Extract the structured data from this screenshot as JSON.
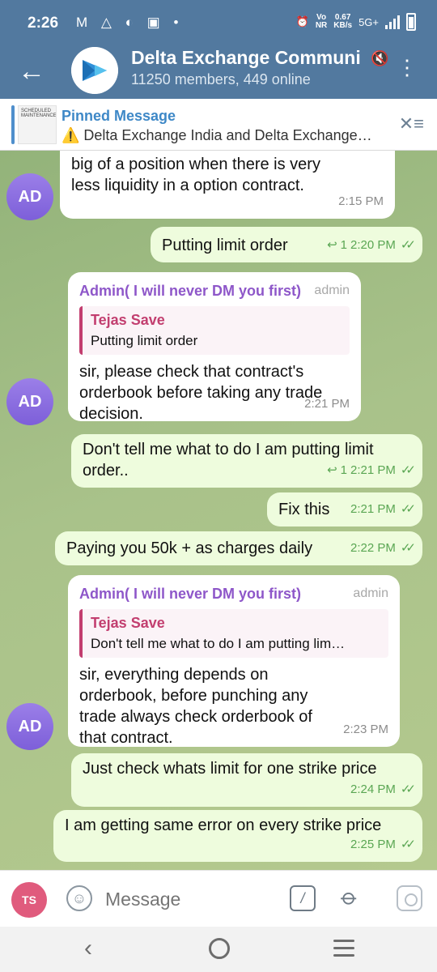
{
  "status_bar": {
    "time": "2:26",
    "net_speed": "0.67",
    "net_unit": "KB/s",
    "network": "5G+",
    "vo": "Vo",
    "nr": "NR"
  },
  "header": {
    "title": "Delta Exchange Communi",
    "subtitle": "11250 members, 449 online"
  },
  "pinned": {
    "title": "Pinned Message",
    "text": "⚠️ Delta Exchange India and Delta Exchange…",
    "thumb_text": "SCHEDULED MAINTENANCE"
  },
  "messages": [
    {
      "id": "m1",
      "direction": "in",
      "text_line1": "big of a position when there is very",
      "text_line2": "less liquidity in a option contract.",
      "time": "2:15 PM",
      "avatar": "AD"
    },
    {
      "id": "m2",
      "direction": "out",
      "text": "Putting limit order",
      "replies": "1",
      "time": "2:20 PM"
    },
    {
      "id": "m3",
      "direction": "in",
      "sender": "Admin( I will never DM you first)",
      "role": "admin",
      "quote_name": "Tejas Save",
      "quote_text": "Putting limit order",
      "text_line1": "sir, please check that contract's",
      "text_line2": "orderbook before taking any trade",
      "text_line3": "decision.",
      "time": "2:21 PM",
      "avatar": "AD"
    },
    {
      "id": "m4",
      "direction": "out",
      "text_line1": "Don't tell me what to do I am putting limit",
      "text_line2": "order..",
      "replies": "1",
      "time": "2:21 PM"
    },
    {
      "id": "m5",
      "direction": "out",
      "text": "Fix this",
      "time": "2:21 PM"
    },
    {
      "id": "m6",
      "direction": "out",
      "text": "Paying you 50k + as charges daily",
      "time": "2:22 PM"
    },
    {
      "id": "m7",
      "direction": "in",
      "sender": "Admin( I will never DM you first)",
      "role": "admin",
      "quote_name": "Tejas Save",
      "quote_text": "Don't tell me what to do I am putting lim…",
      "text_line1": "sir, everything depends on",
      "text_line2": "orderbook, before punching any",
      "text_line3": "trade always check orderbook of",
      "text_line4": "that contract.",
      "time": "2:23 PM",
      "avatar": "AD"
    },
    {
      "id": "m8",
      "direction": "out",
      "text": "Just check whats limit for one strike price",
      "time": "2:24 PM"
    },
    {
      "id": "m9",
      "direction": "out",
      "text": "I am getting same error on every strike price",
      "time": "2:25 PM"
    }
  ],
  "input": {
    "avatar": "TS",
    "placeholder": "Message"
  },
  "colors": {
    "header_bg": "#52799f",
    "outgoing_bubble": "#eefcdd",
    "incoming_bubble": "#ffffff",
    "sender_name": "#8e57c9",
    "quote_accent": "#c23e6f",
    "check_color": "#5aa653",
    "avatar_bg": "#8a6ee0"
  },
  "icons": [
    "back-arrow-icon",
    "mute-icon",
    "more-vertical-icon",
    "unpin-icon",
    "reply-count-icon",
    "double-check-icon",
    "emoji-icon",
    "bot-command-icon",
    "attach-icon",
    "camera-icon",
    "nav-back-icon",
    "nav-home-icon",
    "nav-recent-icon"
  ]
}
